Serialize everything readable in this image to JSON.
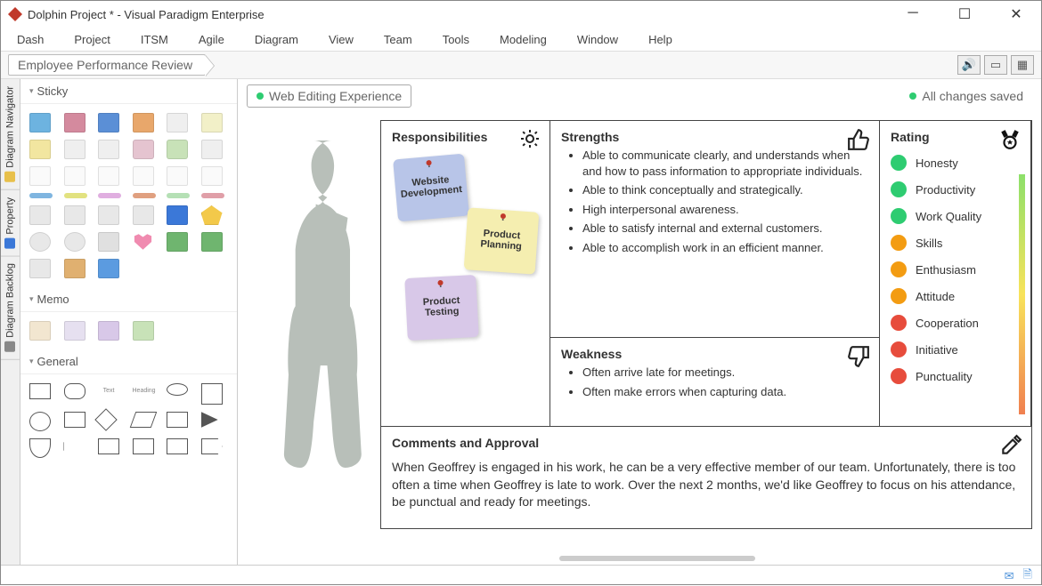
{
  "window": {
    "title": "Dolphin Project * - Visual Paradigm Enterprise"
  },
  "menu": [
    "Dash",
    "Project",
    "ITSM",
    "Agile",
    "Diagram",
    "View",
    "Team",
    "Tools",
    "Modeling",
    "Window",
    "Help"
  ],
  "breadcrumb": "Employee Performance Review",
  "sidetabs": [
    "Diagram Navigator",
    "Property",
    "Diagram Backlog"
  ],
  "palette": {
    "sticky": "Sticky",
    "memo": "Memo",
    "general": "General"
  },
  "chips": {
    "left": "Web Editing Experience",
    "right": "All changes saved"
  },
  "responsibilities": {
    "title": "Responsibilities",
    "notes": [
      "Website Development",
      "Product Planning",
      "Product Testing"
    ]
  },
  "strengths": {
    "title": "Strengths",
    "items": [
      "Able to communicate clearly, and understands when and how to pass information to appropriate individuals.",
      "Able to think conceptually and strategically.",
      "High interpersonal awareness.",
      "Able to satisfy internal and external customers.",
      "Able to accomplish work in an efficient manner."
    ]
  },
  "weakness": {
    "title": "Weakness",
    "items": [
      "Often arrive late for meetings.",
      "Often make errors when capturing data."
    ]
  },
  "rating": {
    "title": "Rating",
    "items": [
      {
        "label": "Honesty",
        "color": "#2ecc71"
      },
      {
        "label": "Productivity",
        "color": "#2ecc71"
      },
      {
        "label": "Work Quality",
        "color": "#2ecc71"
      },
      {
        "label": "Skills",
        "color": "#f39c12"
      },
      {
        "label": "Enthusiasm",
        "color": "#f39c12"
      },
      {
        "label": "Attitude",
        "color": "#f39c12"
      },
      {
        "label": "Cooperation",
        "color": "#e74c3c"
      },
      {
        "label": "Initiative",
        "color": "#e74c3c"
      },
      {
        "label": "Punctuality",
        "color": "#e74c3c"
      }
    ]
  },
  "comments": {
    "title": "Comments and Approval",
    "body": "When Geoffrey is engaged in his work, he can be a very effective member of our team. Unfortunately, there is too often a time when Geoffrey is late to work. Over the next 2 months, we'd like Geoffrey to focus on his attendance, be punctual and ready for meetings."
  }
}
